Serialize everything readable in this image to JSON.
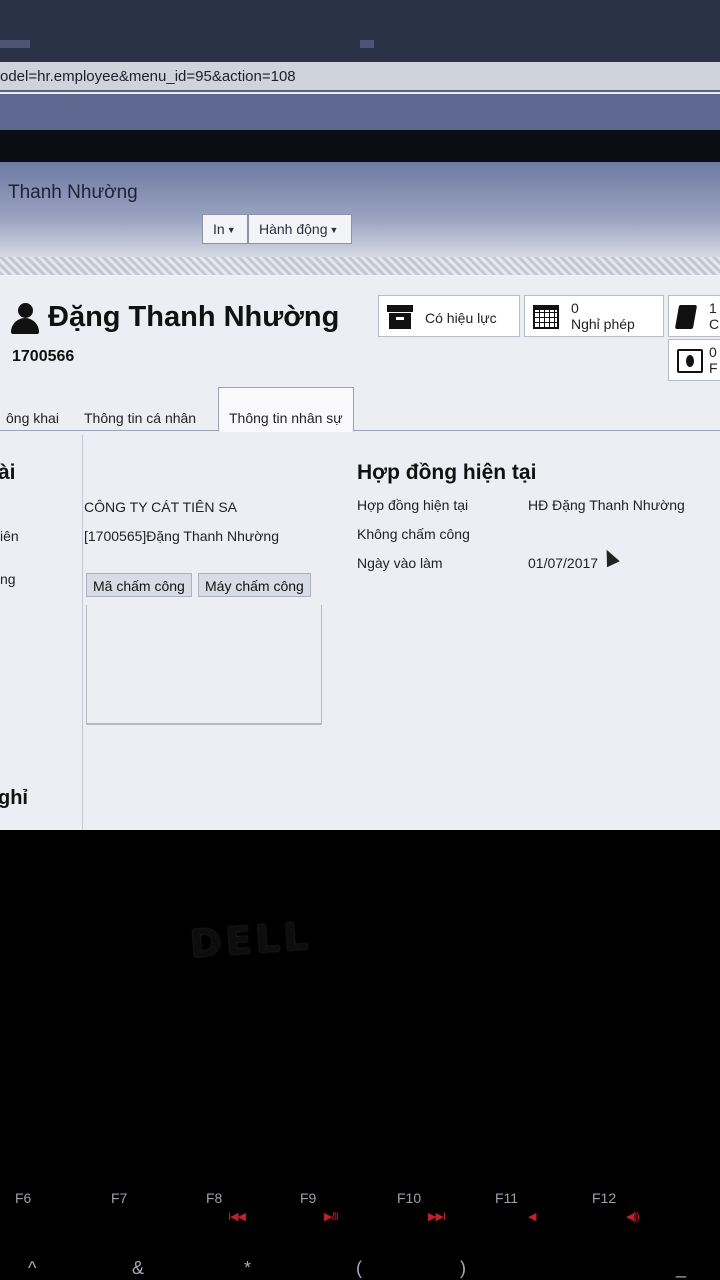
{
  "browser": {
    "url_fragment": "odel=hr.employee&menu_id=95&action=108"
  },
  "header": {
    "title": "Thanh Nhường",
    "buttons": {
      "print_label": "In",
      "action_label": "Hành động"
    }
  },
  "employee": {
    "name": "Đặng Thanh Nhường",
    "code": "1700566"
  },
  "stats": {
    "contract_status": "Có hiệu lực",
    "leave_count": "0",
    "leave_label": "Nghỉ phép",
    "right_count_1": "1",
    "right_count_2": "0",
    "right_label_partial_1": "C",
    "right_label_partial_2": "F"
  },
  "tabs": [
    "ông khai",
    "Thông tin cá nhân",
    "Thông tin nhân sự"
  ],
  "left_section": {
    "title_fragment": "ài",
    "bottom_title_fragment": "ghỉ",
    "rows": [
      {
        "label": "",
        "value": "CÔNG TY CÁT TIÊN SA"
      },
      {
        "label": "iên",
        "value": "[1700565]Đặng Thanh Nhường"
      },
      {
        "label": "ng",
        "value": ""
      }
    ],
    "chips": [
      "Mã chấm công",
      "Máy chấm công"
    ]
  },
  "contract_section": {
    "title": "Hợp đồng hiện tại",
    "rows": [
      {
        "label": "Hợp đồng hiện tại",
        "value": "HĐ Đặng Thanh Nhường"
      },
      {
        "label": "Không chấm công",
        "value": ""
      },
      {
        "label": "Ngày vào làm",
        "value": "01/07/2017"
      }
    ]
  },
  "laptop": {
    "brand": "DELL",
    "function_keys": [
      "F6",
      "F7",
      "F8",
      "F9",
      "F10",
      "F11",
      "F12"
    ],
    "function_glyphs": [
      "",
      "",
      "I◀◀",
      "▶/II",
      "▶▶I",
      "◀",
      "◀))"
    ],
    "key_symbols": [
      "^",
      "&",
      "*",
      "(",
      ")",
      "_"
    ]
  },
  "colors": {
    "header_gradient_top": "#6f7aa3",
    "page_bg": "#eceef3",
    "bezel": "#000000",
    "media_key_red": "#c21f2b"
  }
}
